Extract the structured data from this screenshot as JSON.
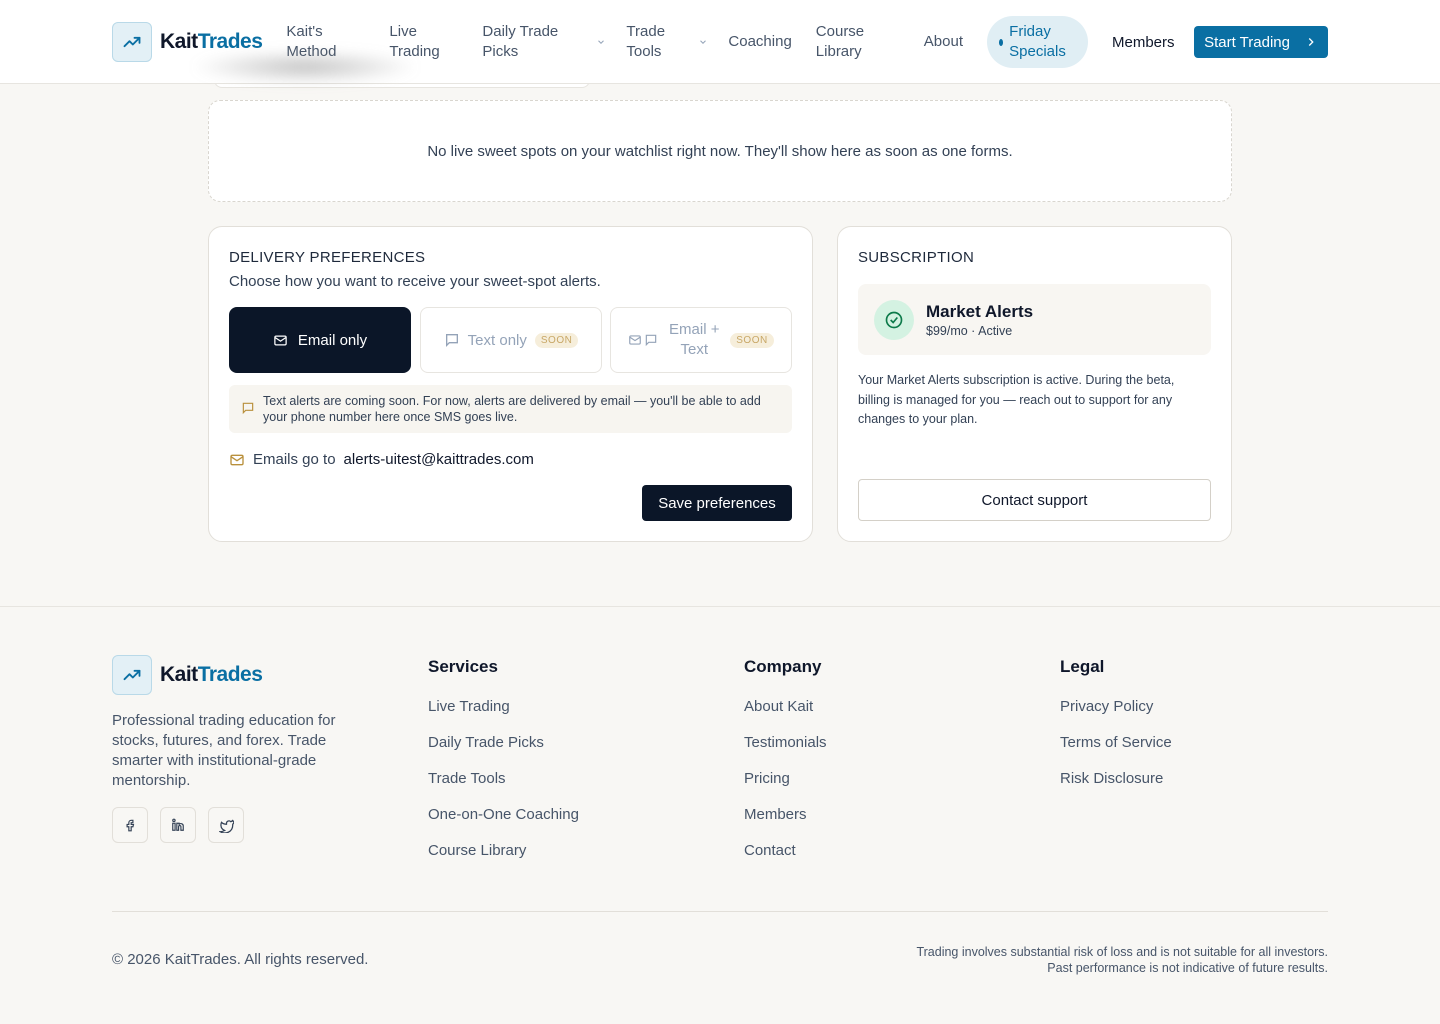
{
  "brand": {
    "name_part1": "Kait",
    "name_part2": "Trades"
  },
  "nav": {
    "items": [
      {
        "label": "Kait's Method"
      },
      {
        "label": "Live Trading"
      },
      {
        "label": "Daily Trade Picks"
      },
      {
        "label": "Trade Tools"
      },
      {
        "label": "Coaching"
      },
      {
        "label": "Course Library"
      },
      {
        "label": "About"
      }
    ],
    "special": "Friday Specials",
    "members": "Members",
    "cta": "Start Trading"
  },
  "watchlist": {
    "empty_message": "No live sweet spots on your watchlist right now. They'll show here as soon as one forms."
  },
  "delivery": {
    "title": "DELIVERY PREFERENCES",
    "subtitle": "Choose how you want to receive your sweet-spot alerts.",
    "options": [
      {
        "label": "Email only"
      },
      {
        "label": "Text only",
        "badge": "SOON"
      },
      {
        "label": "Email + Text",
        "badge": "SOON"
      }
    ],
    "notice": "Text alerts are coming soon. For now, alerts are delivered by email — you'll be able to add your phone number here once SMS goes live.",
    "emails_go_label": "Emails go to",
    "email_address": "alerts-uitest@kaittrades.com",
    "save_label": "Save preferences"
  },
  "subscription": {
    "title": "SUBSCRIPTION",
    "plan_name": "Market Alerts",
    "plan_meta": "$99/mo · Active",
    "description": "Your Market Alerts subscription is active. During the beta, billing is managed for you — reach out to support for any changes to your plan.",
    "contact_label": "Contact support"
  },
  "footer": {
    "tagline": "Professional trading education for stocks, futures, and forex. Trade smarter with institutional-grade mentorship.",
    "columns": [
      {
        "title": "Services",
        "links": [
          "Live Trading",
          "Daily Trade Picks",
          "Trade Tools",
          "One-on-One Coaching",
          "Course Library"
        ]
      },
      {
        "title": "Company",
        "links": [
          "About Kait",
          "Testimonials",
          "Pricing",
          "Members",
          "Contact"
        ]
      },
      {
        "title": "Legal",
        "links": [
          "Privacy Policy",
          "Terms of Service",
          "Risk Disclosure"
        ]
      }
    ],
    "copyright": "© 2026 KaitTrades. All rights reserved.",
    "disclaimer_line1": "Trading involves substantial risk of loss and is not suitable for all investors.",
    "disclaimer_line2": "Past performance is not indicative of future results."
  },
  "colors": {
    "brand": "#0a6fa3",
    "dark": "#0b1628",
    "accent_warm": "#b9903c",
    "success": "#0d7a4a"
  },
  "icons": {
    "logo": "trending-up-icon",
    "social": [
      "facebook-icon",
      "linkedin-icon",
      "twitter-icon"
    ]
  }
}
